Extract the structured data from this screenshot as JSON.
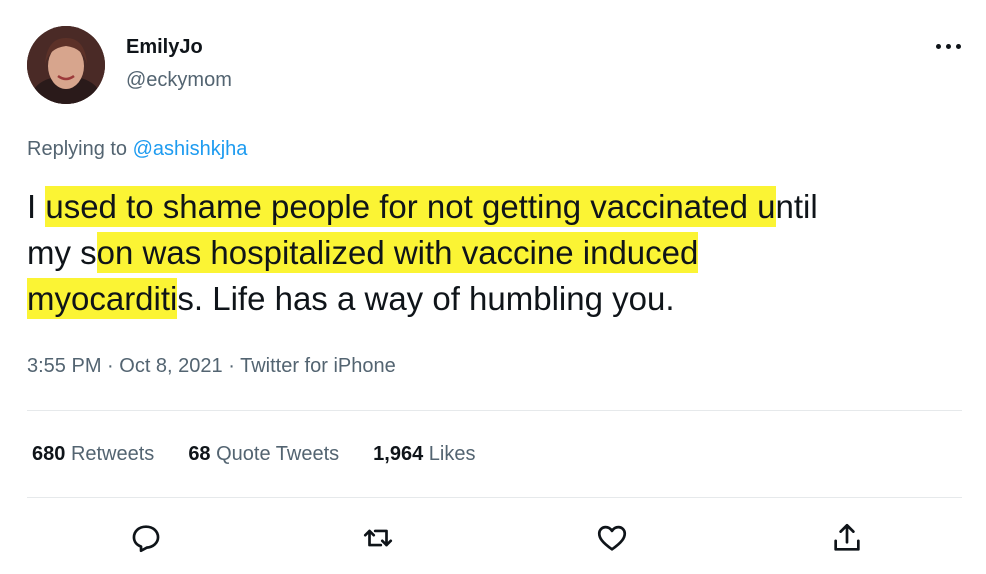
{
  "author": {
    "name": "EmilyJo",
    "handle": "@eckymom"
  },
  "reply": {
    "prefix": "Replying to",
    "to_handle": "@ashishkjha"
  },
  "tweet": {
    "lines": [
      {
        "before": "I ",
        "highlight": "used to shame people for not getting vaccinated u",
        "after": "ntil"
      },
      {
        "before": "my s",
        "highlight": "on was hospitalized with vaccine induced  ",
        "after": ""
      },
      {
        "before": "",
        "highlight": "myocarditi",
        "after": "s. Life has a way of humbling you."
      }
    ],
    "highlight_color": "#fbf434"
  },
  "meta": {
    "time": "3:55 PM",
    "sep1": " · ",
    "date": "Oct 8, 2021",
    "sep2": " · ",
    "source": "Twitter for iPhone"
  },
  "stats": {
    "retweets_count": "680",
    "retweets_label": "Retweets",
    "quotes_count": "68",
    "quotes_label": "Quote Tweets",
    "likes_count": "1,964",
    "likes_label": "Likes"
  },
  "icons": {
    "reply": "reply-icon",
    "retweet": "retweet-icon",
    "like": "like-icon",
    "share": "share-icon",
    "more": "more-icon"
  },
  "colors": {
    "text": "#0f1419",
    "secondary": "#536471",
    "link": "#1d9bf0"
  }
}
